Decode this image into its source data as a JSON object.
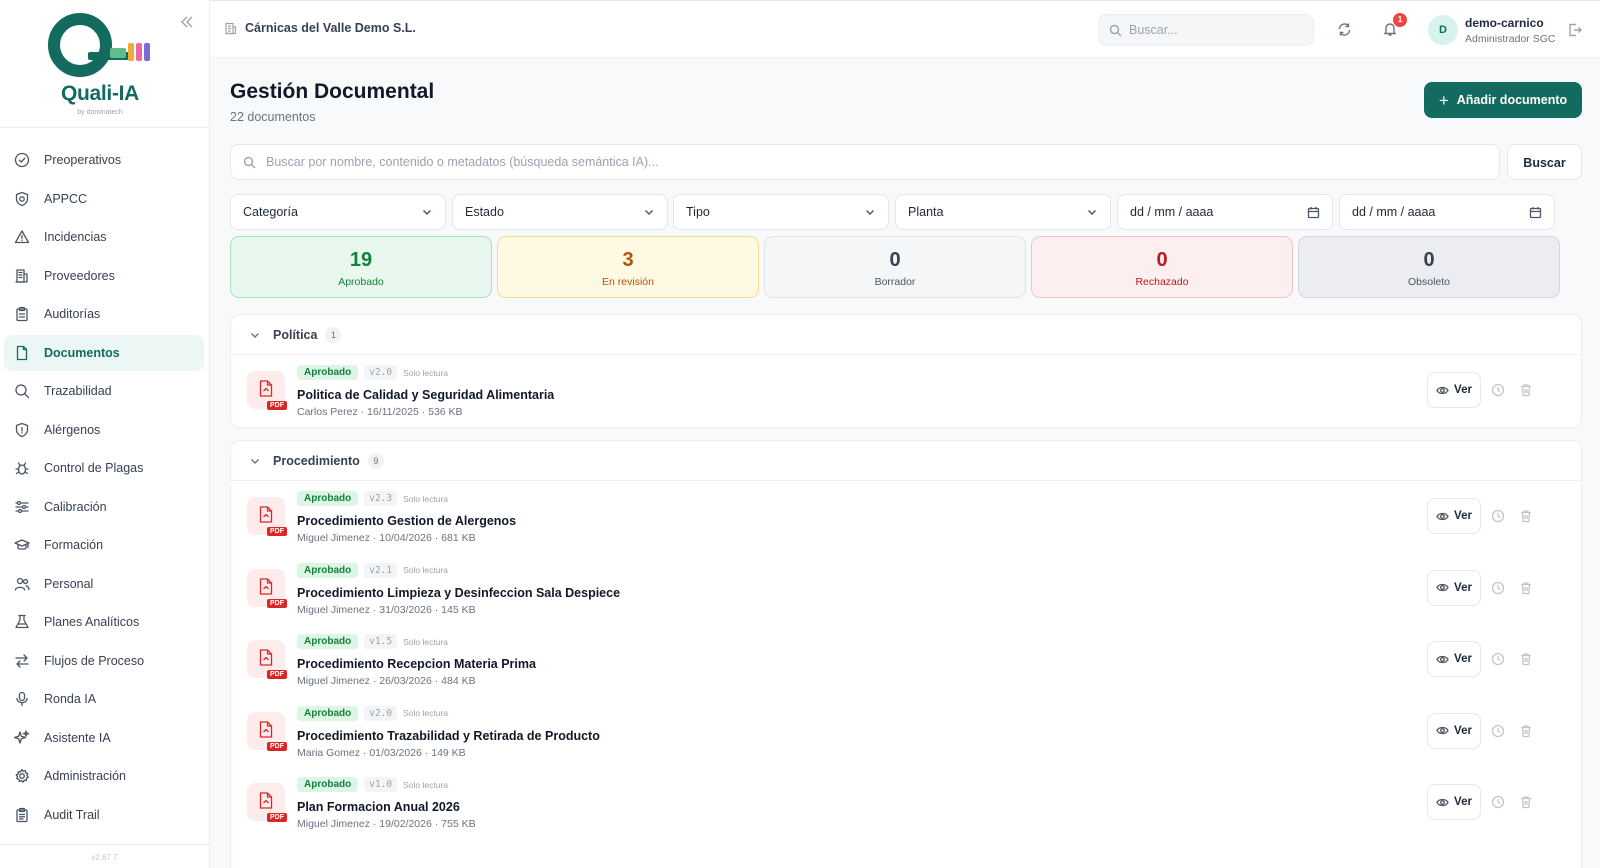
{
  "sidebar": {
    "logo_text": "Quali-IA",
    "logo_sub": "by dominatech",
    "version": "v2.67.7",
    "items": [
      {
        "label": "Preoperativos",
        "icon": "circle-check-icon"
      },
      {
        "label": "APPCC",
        "icon": "shield-target-icon"
      },
      {
        "label": "Incidencias",
        "icon": "alert-triangle-icon"
      },
      {
        "label": "Proveedores",
        "icon": "building-icon"
      },
      {
        "label": "Auditorías",
        "icon": "clipboard-icon"
      },
      {
        "label": "Documentos",
        "icon": "file-icon",
        "active": true
      },
      {
        "label": "Trazabilidad",
        "icon": "search-icon"
      },
      {
        "label": "Alérgenos",
        "icon": "shield-icon"
      },
      {
        "label": "Control de Plagas",
        "icon": "bug-icon"
      },
      {
        "label": "Calibración",
        "icon": "sliders-icon"
      },
      {
        "label": "Formación",
        "icon": "graduation-cap-icon"
      },
      {
        "label": "Personal",
        "icon": "users-icon"
      },
      {
        "label": "Planes Analíticos",
        "icon": "flask-icon"
      },
      {
        "label": "Flujos de Proceso",
        "icon": "arrows-swap-icon"
      },
      {
        "label": "Ronda IA",
        "icon": "microphone-icon"
      },
      {
        "label": "Asistente IA",
        "icon": "sparkles-icon"
      },
      {
        "label": "Administración",
        "icon": "gear-icon"
      },
      {
        "label": "Audit Trail",
        "icon": "clipboard-list-icon"
      }
    ]
  },
  "topbar": {
    "company": "Cárnicas del Valle Demo S.L.",
    "search_placeholder": "Buscar...",
    "notifications": "1",
    "user_initial": "D",
    "user_name": "demo-carnico",
    "user_role": "Administrador SGC"
  },
  "page": {
    "title": "Gestión Documental",
    "count": "22 documentos",
    "add_label": "Añadir documento",
    "search_placeholder": "Buscar por nombre, contenido o metadatos (búsqueda semántica IA)...",
    "search_button": "Buscar"
  },
  "filters": [
    "Categoría",
    "Estado",
    "Tipo",
    "Planta"
  ],
  "date_filters": [
    "dd / mm / aaaa",
    "dd / mm / aaaa"
  ],
  "stats": [
    {
      "value": "19",
      "label": "Aprobado",
      "bg": "#e9f8ef",
      "border": "#a7e3bd",
      "color": "#15803d"
    },
    {
      "value": "3",
      "label": "En revisión",
      "bg": "#fef9e3",
      "border": "#f3de8a",
      "color": "#b45309"
    },
    {
      "value": "0",
      "label": "Borrador",
      "bg": "#f5f6f7",
      "border": "#dfe2e6",
      "color": "#374151"
    },
    {
      "value": "0",
      "label": "Rechazado",
      "bg": "#fdeff0",
      "border": "#f5c2c4",
      "color": "#b91c1c"
    },
    {
      "value": "0",
      "label": "Obsoleto",
      "bg": "#ebedf0",
      "border": "#d4d8dd",
      "color": "#374151"
    }
  ],
  "groups": [
    {
      "name": "Política",
      "count": "1",
      "docs": [
        {
          "status": "Aprobado",
          "version": "v2.0",
          "readonly": "Solo lectura",
          "title": "Politica de Calidad y Seguridad Alimentaria",
          "meta": "Carlos Perez · 16/11/2025 · 536 KB"
        }
      ]
    },
    {
      "name": "Procedimiento",
      "count": "9",
      "docs": [
        {
          "status": "Aprobado",
          "version": "v2.3",
          "readonly": "Solo lectura",
          "title": "Procedimiento Gestion de Alergenos",
          "meta": "Miguel Jimenez · 10/04/2026 · 681 KB"
        },
        {
          "status": "Aprobado",
          "version": "v2.1",
          "readonly": "Solo lectura",
          "title": "Procedimiento Limpieza y Desinfeccion Sala Despiece",
          "meta": "Miguel Jimenez · 31/03/2026 · 145 KB"
        },
        {
          "status": "Aprobado",
          "version": "v1.5",
          "readonly": "Solo lectura",
          "title": "Procedimiento Recepcion Materia Prima",
          "meta": "Miguel Jimenez · 26/03/2026 · 484 KB"
        },
        {
          "status": "Aprobado",
          "version": "v2.0",
          "readonly": "Solo lectura",
          "title": "Procedimiento Trazabilidad y Retirada de Producto",
          "meta": "Maria Gomez · 01/03/2026 · 149 KB"
        },
        {
          "status": "Aprobado",
          "version": "v1.0",
          "readonly": "Solo lectura",
          "title": "Plan Formacion Anual 2026",
          "meta": "Miguel Jimenez · 19/02/2026 · 755 KB"
        }
      ]
    }
  ],
  "pdf_label": "PDF",
  "view_label": "Ver"
}
